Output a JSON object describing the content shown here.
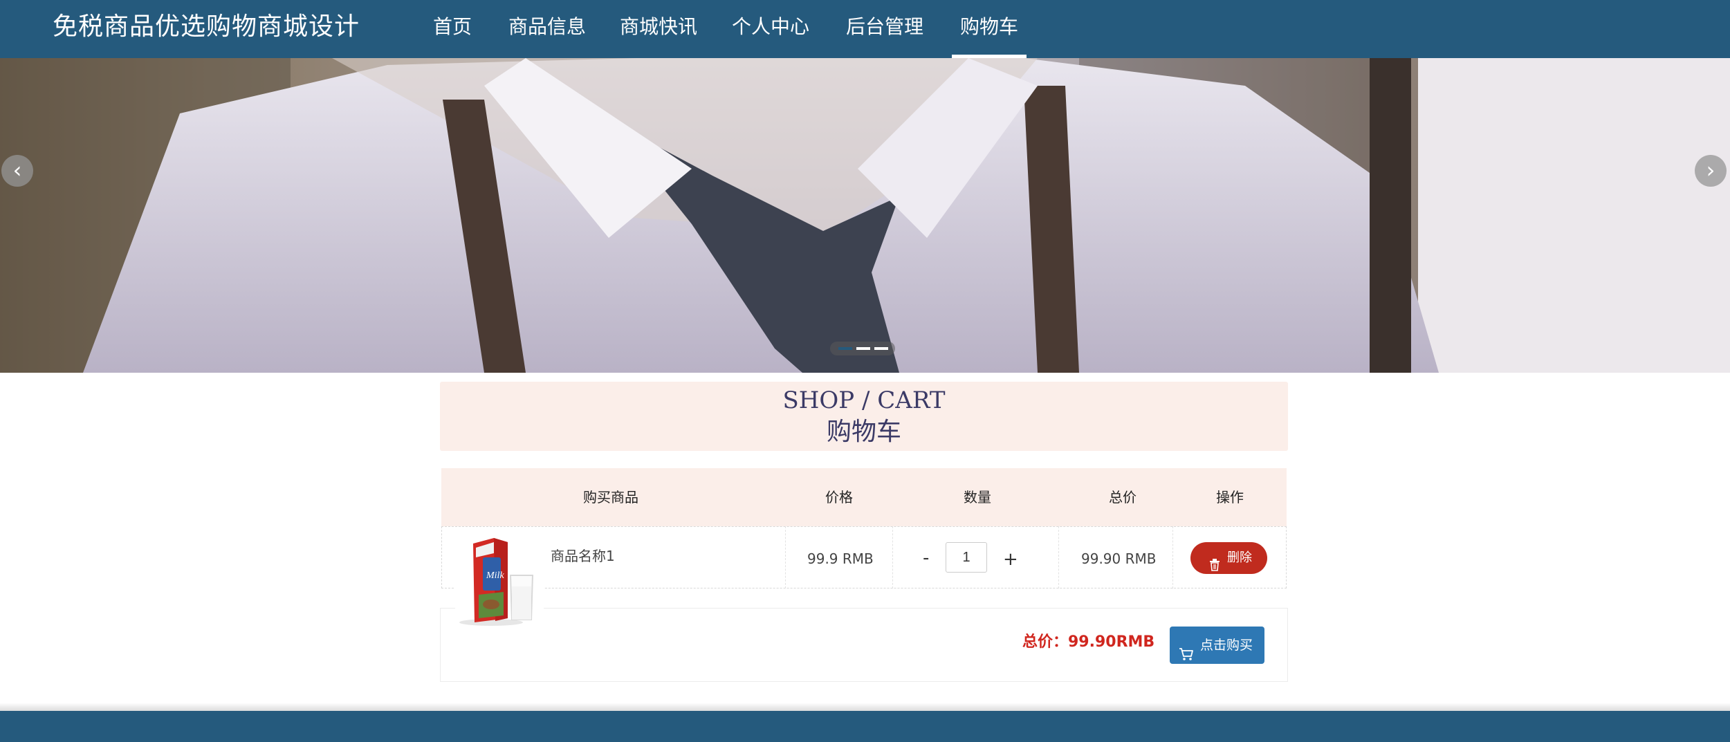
{
  "site": {
    "title": "免税商品优选购物商城设计"
  },
  "nav": {
    "items": [
      {
        "label": "首页"
      },
      {
        "label": "商品信息"
      },
      {
        "label": "商城快讯"
      },
      {
        "label": "个人中心"
      },
      {
        "label": "后台管理"
      },
      {
        "label": "购物车",
        "active": true
      }
    ]
  },
  "banner": {
    "prev_icon": "chevron-left-icon",
    "next_icon": "chevron-right-icon",
    "slide_count": 3,
    "active_slide": 1
  },
  "cart": {
    "title_en": "SHOP / CART",
    "title_cn": "购物车",
    "columns": [
      "购买商品",
      "价格",
      "数量",
      "总价",
      "操作"
    ],
    "items": [
      {
        "name": "商品名称1",
        "price": "99.9 RMB",
        "quantity": "1",
        "minus": "-",
        "plus": "+",
        "subtotal": "99.90 RMB",
        "delete_label": "删除",
        "delete_icon": "trash-icon"
      }
    ],
    "total_label": "总价：99.90RMB",
    "buy_label": "点击购买",
    "buy_icon": "cart-icon"
  },
  "colors": {
    "header_bg": "#255a7d",
    "cart_header_bg": "#fbeee9",
    "delete_btn": "#c02b1e",
    "buy_btn": "#2e78b4",
    "total_text": "#d0261e"
  }
}
